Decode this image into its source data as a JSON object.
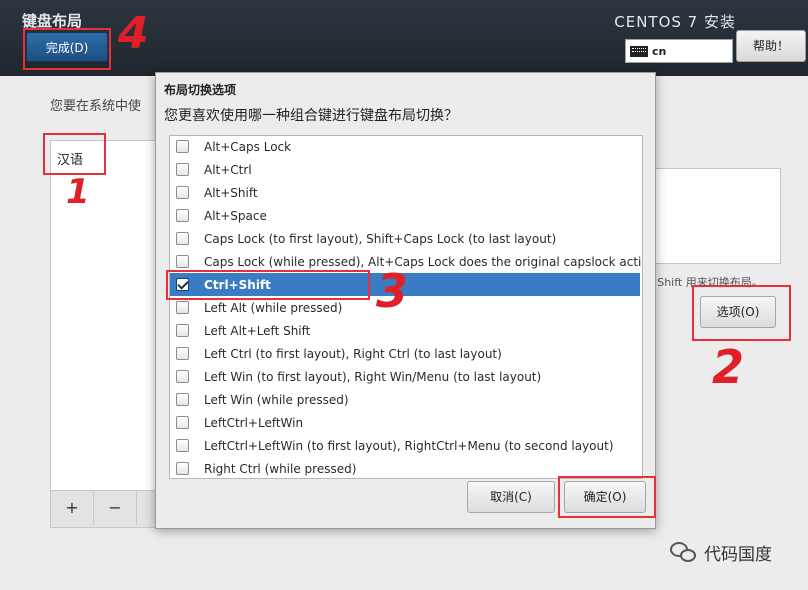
{
  "header": {
    "page_title": "键盘布局",
    "done_button": "完成(D)",
    "product_title": "CENTOS 7 安装",
    "keyboard_indicator": "cn",
    "help_button": "帮助！"
  },
  "main": {
    "prompt": "您要在系统中使",
    "languages": [
      "汉语"
    ],
    "hint": "+Shift 用来切换布局。",
    "options_button": "选项(O)",
    "toolbar": [
      "+",
      "−"
    ]
  },
  "dialog": {
    "title": "布局切换选项",
    "question": "您更喜欢使用哪一种组合键进行键盘布局切换？",
    "options": [
      {
        "label": "Alt+Caps Lock",
        "checked": false
      },
      {
        "label": "Alt+Ctrl",
        "checked": false
      },
      {
        "label": "Alt+Shift",
        "checked": false
      },
      {
        "label": "Alt+Space",
        "checked": false
      },
      {
        "label": "Caps Lock (to first layout), Shift+Caps Lock (to last layout)",
        "checked": false
      },
      {
        "label": "Caps Lock (while pressed), Alt+Caps Lock does the original capslock action",
        "checked": false
      },
      {
        "label": "Ctrl+Shift",
        "checked": true
      },
      {
        "label": "Left Alt (while pressed)",
        "checked": false
      },
      {
        "label": "Left Alt+Left Shift",
        "checked": false
      },
      {
        "label": "Left Ctrl (to first layout), Right Ctrl (to last layout)",
        "checked": false
      },
      {
        "label": "Left Win (to first layout), Right Win/Menu (to last layout)",
        "checked": false
      },
      {
        "label": "Left Win (while pressed)",
        "checked": false
      },
      {
        "label": "LeftCtrl+LeftWin",
        "checked": false
      },
      {
        "label": "LeftCtrl+LeftWin (to first layout), RightCtrl+Menu (to second layout)",
        "checked": false
      },
      {
        "label": "Right Ctrl (while pressed)",
        "checked": false
      }
    ],
    "cancel_button": "取消(C)",
    "ok_button": "确定(O)"
  },
  "annotations": [
    "4",
    "1",
    "2",
    "3"
  ],
  "watermark": "代码国度",
  "colors": {
    "accent": "#3a7cc4",
    "annotation": "#e8303a",
    "topbar": "#262e36"
  }
}
